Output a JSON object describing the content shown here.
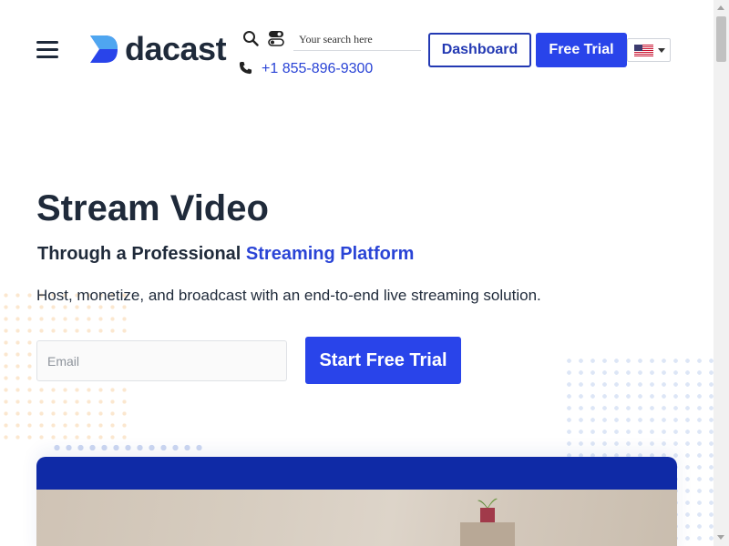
{
  "header": {
    "brand_name": "dacast",
    "search_placeholder": "Your search here",
    "phone": "+1 855-896-9300",
    "dashboard_label": "Dashboard",
    "free_trial_label": "Free Trial",
    "language_flag": "us-flag-icon"
  },
  "hero": {
    "title": "Stream Video",
    "subtitle_prefix": "Through a Professional ",
    "subtitle_accent": "Streaming Platform",
    "description": "Host, monetize, and broadcast with an end-to-end live streaming solution.",
    "email_placeholder": "Email",
    "cta_label": "Start Free Trial"
  },
  "colors": {
    "primary": "#2944ea",
    "dark_blue": "#0f2aa6",
    "text": "#1f2a3a",
    "link": "#2a44d6"
  }
}
